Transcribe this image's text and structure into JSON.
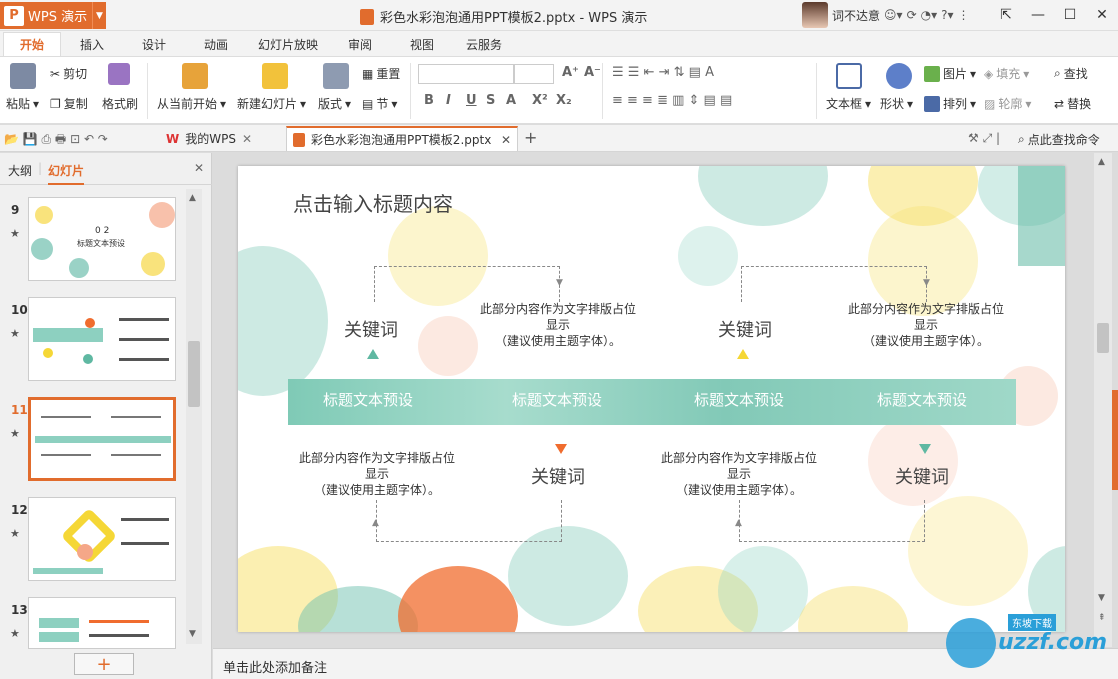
{
  "app": {
    "name": "WPS 演示",
    "window_title": "彩色水彩泡泡通用PPT模板2.pptx - WPS 演示",
    "user": "词不达意"
  },
  "menu": {
    "tabs": [
      "开始",
      "插入",
      "设计",
      "动画",
      "幻灯片放映",
      "审阅",
      "视图",
      "云服务"
    ]
  },
  "ribbon": {
    "paste": "粘贴",
    "cut": "剪切",
    "copy": "复制",
    "format_painter": "格式刷",
    "from_current": "从当前开始",
    "new_slide": "新建幻灯片",
    "layout": "版式",
    "reset": "重置",
    "section": "节",
    "textbox": "文本框",
    "shape": "形状",
    "picture": "图片",
    "fill": "填充",
    "arrange": "排列",
    "outline": "轮廓",
    "find": "查找",
    "replace": "替换",
    "font_buttons": [
      "B",
      "I",
      "U",
      "S",
      "A",
      "X²",
      "X₂"
    ]
  },
  "quickbar": {
    "tab_mywps": "我的WPS",
    "tab_doc": "彩色水彩泡泡通用PPT模板2.pptx",
    "find_cmd": "点此查找命令"
  },
  "left_panel": {
    "tabs": [
      "大纲",
      "幻灯片"
    ],
    "thumbs": [
      {
        "num": "9",
        "title": "0 2",
        "sub": "标题文本预设"
      },
      {
        "num": "10"
      },
      {
        "num": "11",
        "selected": true
      },
      {
        "num": "12"
      },
      {
        "num": "13"
      }
    ]
  },
  "slide": {
    "title": "点击输入标题内容",
    "keyword": "关键词",
    "body_line1": "此部分内容作为文字排版占位",
    "body_line2": "显示",
    "body_line3": "（建议使用主题字体）。",
    "band_labels": [
      "标题文本预设",
      "标题文本预设",
      "标题文本预设",
      "标题文本预设"
    ],
    "colors": {
      "teal": "#5fb8a2",
      "yellow": "#f5d736",
      "orange": "#f06c2e"
    }
  },
  "notes": "单击此处添加备注",
  "watermark": "uzzf.com"
}
